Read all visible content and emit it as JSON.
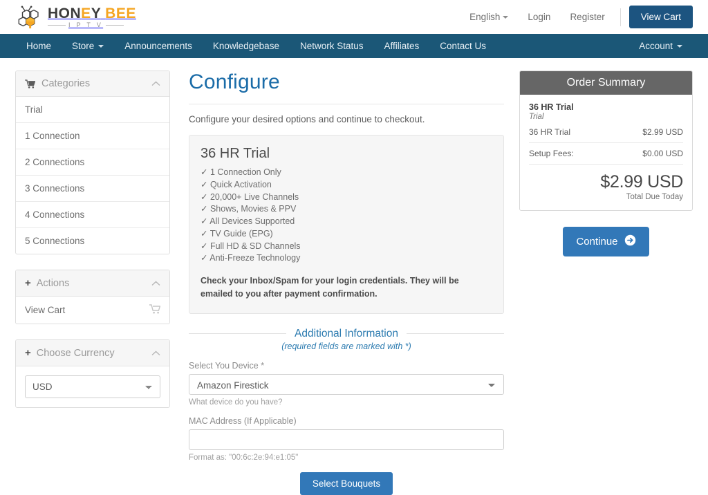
{
  "topbar": {
    "logo": {
      "word1": "HON",
      "word1b": "Y",
      "accent_letter": "E",
      "word2": "BEE",
      "subtitle": "I P T V",
      "icon": "honeycomb-bee-icon"
    },
    "language": "English",
    "login": "Login",
    "register": "Register",
    "view_cart": "View Cart"
  },
  "nav": {
    "items": [
      {
        "label": "Home",
        "caret": false
      },
      {
        "label": "Store",
        "caret": true
      },
      {
        "label": "Announcements",
        "caret": false
      },
      {
        "label": "Knowledgebase",
        "caret": false
      },
      {
        "label": "Network Status",
        "caret": false
      },
      {
        "label": "Affiliates",
        "caret": false
      },
      {
        "label": "Contact Us",
        "caret": false
      }
    ],
    "account": {
      "label": "Account",
      "caret": true
    }
  },
  "sidebar": {
    "categories": {
      "title": "Categories",
      "icon": "cart-icon",
      "collapse_icon": "chevron-up-icon",
      "items": [
        "Trial",
        "1 Connection",
        "2 Connections",
        "3 Connections",
        "4 Connections",
        "5 Connections"
      ]
    },
    "actions": {
      "title": "Actions",
      "icon": "plus-icon",
      "collapse_icon": "chevron-up-icon",
      "items": [
        {
          "label": "View Cart",
          "icon": "cart-icon"
        }
      ]
    },
    "currency": {
      "title": "Choose Currency",
      "icon": "plus-icon",
      "collapse_icon": "chevron-up-icon",
      "selected": "USD",
      "options": [
        "USD"
      ]
    }
  },
  "main": {
    "page_title": "Configure",
    "intro": "Configure your desired options and continue to checkout.",
    "product": {
      "title": "36 HR Trial",
      "features": [
        "✓ 1 Connection Only",
        "✓ Quick Activation",
        "✓ 20,000+ Live Channels",
        "✓ Shows, Movies & PPV",
        "✓ All Devices Supported",
        "✓ TV Guide (EPG)",
        "✓ Full HD & SD Channels",
        "✓ Anti-Freeze Technology"
      ],
      "note": "Check your Inbox/Spam for your login credentials. They will be emailed to you after payment confirmation."
    },
    "additional_info": {
      "heading": "Additional Information",
      "subheading": "(required fields are marked with *)",
      "device": {
        "label": "Select You Device *",
        "value": "Amazon Firestick",
        "options": [
          "Amazon Firestick"
        ],
        "help": "What device do you have?"
      },
      "mac": {
        "label": "MAC Address (If Applicable)",
        "value": "",
        "placeholder": "",
        "help": "Format as: \"00:6c:2e:94:e1:05\""
      }
    },
    "submit_label": "Select Bouquets"
  },
  "order_summary": {
    "title": "Order Summary",
    "product_name": "36 HR Trial",
    "billing_cycle": "Trial",
    "rows": [
      {
        "label": "36 HR Trial",
        "value": "$2.99 USD"
      },
      {
        "label": "Setup Fees:",
        "value": "$0.00 USD"
      }
    ],
    "total_amount": "$2.99 USD",
    "total_label": "Total Due Today",
    "continue_label": "Continue",
    "continue_icon": "arrow-circle-right-icon"
  },
  "colors": {
    "nav_bg": "#1b5777",
    "brand_blue": "#1b6ca8",
    "button_blue": "#3278b8",
    "cart_button": "#1c5480",
    "logo_accent": "#f5a623",
    "summary_header": "#666666"
  }
}
